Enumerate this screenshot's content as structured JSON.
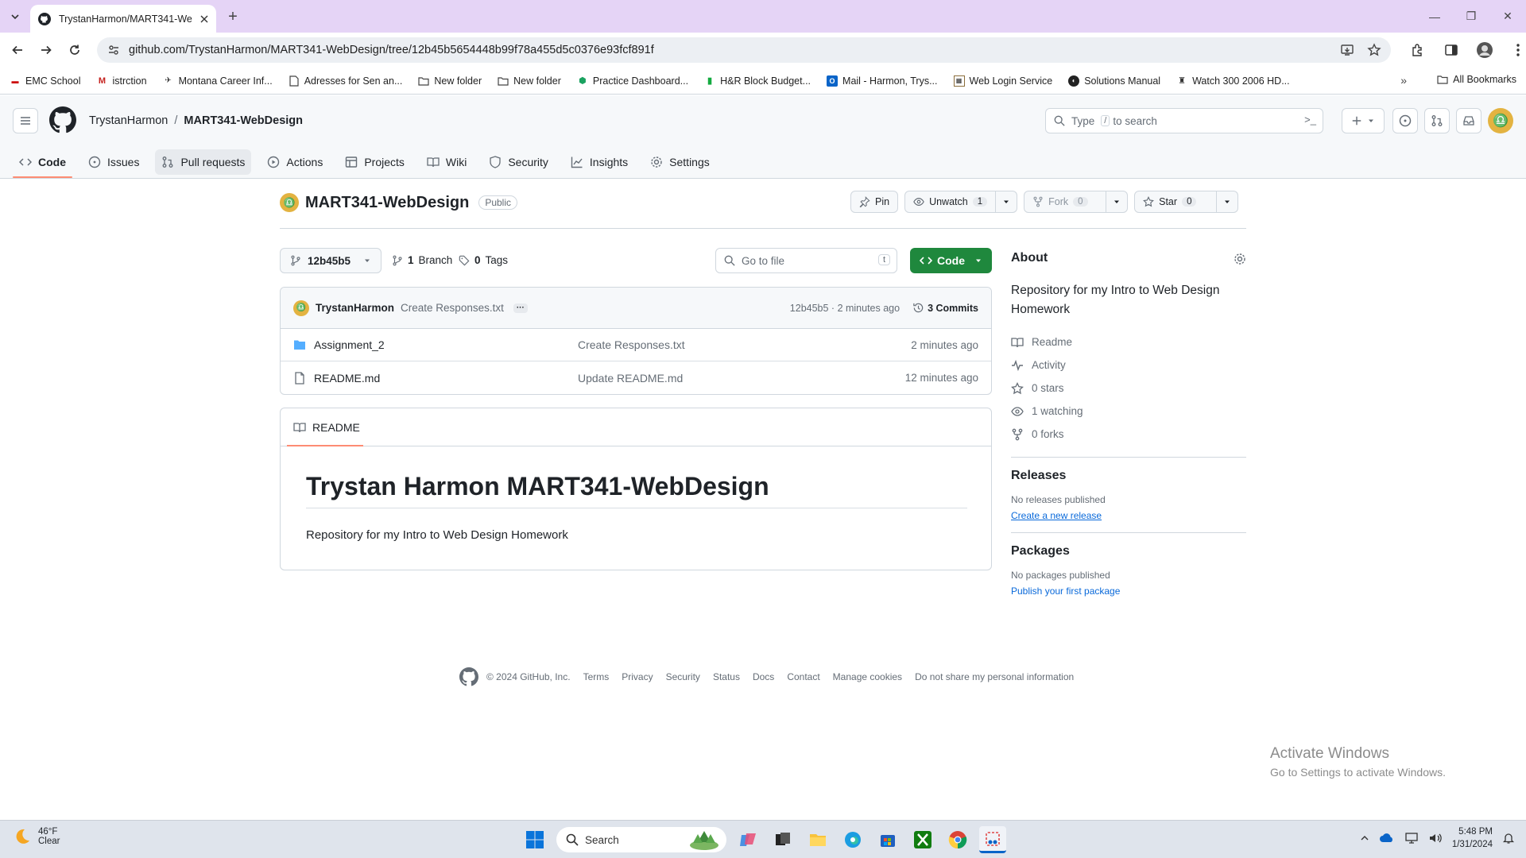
{
  "browser": {
    "tab_title": "TrystanHarmon/MART341-Web",
    "url": "github.com/TrystanHarmon/MART341-WebDesign/tree/12b45b5654448b99f78a455d5c0376e93fcf891f",
    "bookmarks": [
      {
        "label": "EMC School",
        "icon": "emc-icon"
      },
      {
        "label": "istrction",
        "icon": "gmail-icon"
      },
      {
        "label": "Montana Career Inf...",
        "icon": "mci-icon"
      },
      {
        "label": "Adresses for Sen an...",
        "icon": "doc-icon"
      },
      {
        "label": "New folder",
        "icon": "folder-icon"
      },
      {
        "label": "New folder",
        "icon": "folder-icon"
      },
      {
        "label": "Practice Dashboard...",
        "icon": "practice-icon"
      },
      {
        "label": "H&R Block Budget...",
        "icon": "hr-block-icon"
      },
      {
        "label": "Mail - Harmon, Trys...",
        "icon": "outlook-icon"
      },
      {
        "label": "Web Login Service",
        "icon": "web-login-icon"
      },
      {
        "label": "Solutions Manual",
        "icon": "solutions-icon"
      },
      {
        "label": "Watch 300 2006 HD...",
        "icon": "watch-icon"
      }
    ],
    "all_bookmarks": "All Bookmarks"
  },
  "github": {
    "owner": "TrystanHarmon",
    "repo": "MART341-WebDesign",
    "search_placeholder_pre": "Type",
    "search_key": "/",
    "search_placeholder_post": "to search",
    "nav": [
      {
        "label": "Code",
        "icon": "code-icon",
        "active": true
      },
      {
        "label": "Issues",
        "icon": "issue-icon"
      },
      {
        "label": "Pull requests",
        "icon": "pull-request-icon"
      },
      {
        "label": "Actions",
        "icon": "play-icon"
      },
      {
        "label": "Projects",
        "icon": "table-icon"
      },
      {
        "label": "Wiki",
        "icon": "book-icon"
      },
      {
        "label": "Security",
        "icon": "shield-icon"
      },
      {
        "label": "Insights",
        "icon": "graph-icon"
      },
      {
        "label": "Settings",
        "icon": "gear-icon"
      }
    ],
    "visibility": "Public",
    "pin_label": "Pin",
    "unwatch_label": "Unwatch",
    "watch_count": "1",
    "fork_label": "Fork",
    "fork_count": "0",
    "star_label": "Star",
    "star_count": "0",
    "branch": "12b45b5",
    "branch_count": "1",
    "branch_label": "Branch",
    "tag_count": "0",
    "tag_label": "Tags",
    "goto_placeholder": "Go to file",
    "goto_key": "t",
    "code_button": "Code",
    "commit": {
      "user": "TrystanHarmon",
      "message": "Create Responses.txt",
      "sha_time": "12b45b5 · 2 minutes ago",
      "commits": "3 Commits"
    },
    "files": [
      {
        "name": "Assignment_2",
        "type": "folder",
        "message": "Create Responses.txt",
        "time": "2 minutes ago"
      },
      {
        "name": "README.md",
        "type": "file",
        "message": "Update README.md",
        "time": "12 minutes ago"
      }
    ],
    "readme": {
      "tab": "README",
      "heading": "Trystan Harmon MART341-WebDesign",
      "body": "Repository for my Intro to Web Design Homework"
    },
    "about": {
      "title": "About",
      "description": "Repository for my Intro to Web Design Homework",
      "links": [
        {
          "label": "Readme",
          "icon": "book-icon"
        },
        {
          "label": "Activity",
          "icon": "pulse-icon"
        },
        {
          "label": "0 stars",
          "icon": "star-icon"
        },
        {
          "label": "1 watching",
          "icon": "eye-icon"
        },
        {
          "label": "0 forks",
          "icon": "fork-icon"
        }
      ],
      "releases_title": "Releases",
      "releases_none": "No releases published",
      "releases_link": "Create a new release",
      "packages_title": "Packages",
      "packages_none": "No packages published",
      "packages_link": "Publish your first package"
    },
    "footer": {
      "copyright": "© 2024 GitHub, Inc.",
      "links": [
        "Terms",
        "Privacy",
        "Security",
        "Status",
        "Docs",
        "Contact",
        "Manage cookies",
        "Do not share my personal information"
      ]
    }
  },
  "watermark": {
    "line1": "Activate Windows",
    "line2": "Go to Settings to activate Windows."
  },
  "taskbar": {
    "temp": "46°F",
    "condition": "Clear",
    "search": "Search",
    "time": "5:48 PM",
    "date": "1/31/2024"
  },
  "colors": {
    "tab_bar": "#e5d4f6",
    "primary_green": "#1f883d",
    "link_blue": "#0969da",
    "active_underline": "#fd8c73",
    "avatar": "#e3b341"
  }
}
